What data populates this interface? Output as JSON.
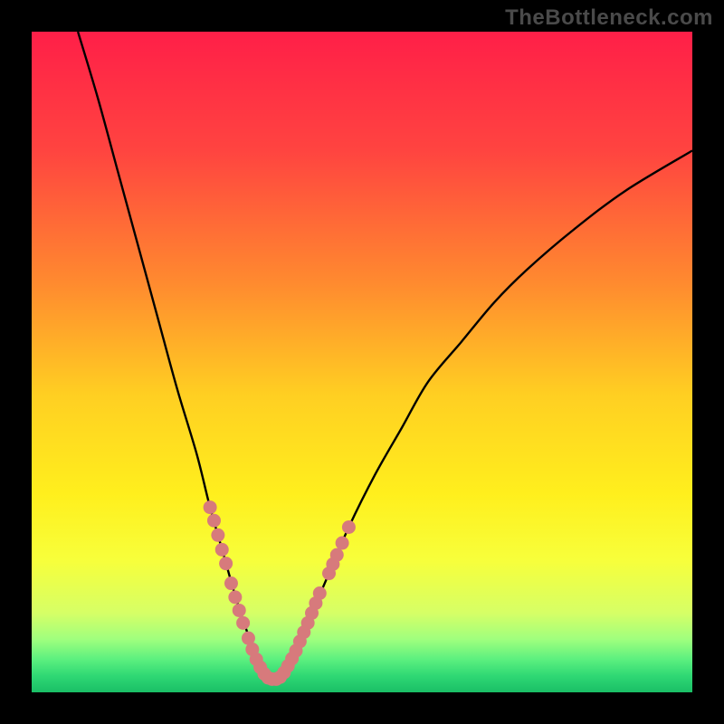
{
  "watermark": "TheBottleneck.com",
  "colors": {
    "frame": "#000000",
    "curve": "#000000",
    "markers": "#d77a7c",
    "gradient_stops": [
      {
        "offset": 0.0,
        "color": "#ff1f48"
      },
      {
        "offset": 0.18,
        "color": "#ff4440"
      },
      {
        "offset": 0.38,
        "color": "#ff8a2f"
      },
      {
        "offset": 0.55,
        "color": "#ffcf22"
      },
      {
        "offset": 0.7,
        "color": "#ffef1d"
      },
      {
        "offset": 0.8,
        "color": "#f7ff3b"
      },
      {
        "offset": 0.88,
        "color": "#d6ff66"
      },
      {
        "offset": 0.92,
        "color": "#9fff7e"
      },
      {
        "offset": 0.95,
        "color": "#5cf07f"
      },
      {
        "offset": 0.975,
        "color": "#2fd874"
      },
      {
        "offset": 1.0,
        "color": "#1abf66"
      }
    ]
  },
  "chart_data": {
    "type": "line",
    "title": "",
    "xlabel": "",
    "ylabel": "",
    "xlim": [
      0,
      100
    ],
    "ylim": [
      0,
      100
    ],
    "series": [
      {
        "name": "bottleneck-curve",
        "x": [
          7,
          10,
          13,
          16,
          19,
          22,
          25,
          27,
          29,
          31,
          33,
          34,
          35,
          36,
          37,
          38,
          40,
          42,
          45,
          48,
          52,
          56,
          60,
          65,
          70,
          75,
          82,
          90,
          100
        ],
        "values": [
          100,
          90,
          79,
          68,
          57,
          46,
          36,
          28,
          21,
          14,
          8,
          5,
          3,
          2,
          2,
          3,
          6,
          11,
          18,
          25,
          33,
          40,
          47,
          53,
          59,
          64,
          70,
          76,
          82
        ]
      }
    ],
    "markers": [
      {
        "x": 27.0,
        "y": 28.0
      },
      {
        "x": 27.6,
        "y": 26.0
      },
      {
        "x": 28.2,
        "y": 23.8
      },
      {
        "x": 28.8,
        "y": 21.6
      },
      {
        "x": 29.4,
        "y": 19.5
      },
      {
        "x": 30.2,
        "y": 16.5
      },
      {
        "x": 30.8,
        "y": 14.4
      },
      {
        "x": 31.4,
        "y": 12.4
      },
      {
        "x": 32.0,
        "y": 10.5
      },
      {
        "x": 32.8,
        "y": 8.2
      },
      {
        "x": 33.4,
        "y": 6.5
      },
      {
        "x": 34.0,
        "y": 5.0
      },
      {
        "x": 34.6,
        "y": 3.8
      },
      {
        "x": 35.2,
        "y": 2.8
      },
      {
        "x": 35.8,
        "y": 2.2
      },
      {
        "x": 36.4,
        "y": 2.0
      },
      {
        "x": 37.0,
        "y": 2.0
      },
      {
        "x": 37.6,
        "y": 2.3
      },
      {
        "x": 38.2,
        "y": 3.0
      },
      {
        "x": 38.8,
        "y": 4.0
      },
      {
        "x": 39.4,
        "y": 5.1
      },
      {
        "x": 40.0,
        "y": 6.3
      },
      {
        "x": 40.6,
        "y": 7.7
      },
      {
        "x": 41.2,
        "y": 9.1
      },
      {
        "x": 41.8,
        "y": 10.5
      },
      {
        "x": 42.4,
        "y": 12.0
      },
      {
        "x": 43.0,
        "y": 13.5
      },
      {
        "x": 43.6,
        "y": 15.0
      },
      {
        "x": 45.0,
        "y": 18.0
      },
      {
        "x": 45.6,
        "y": 19.4
      },
      {
        "x": 46.2,
        "y": 20.8
      },
      {
        "x": 47.0,
        "y": 22.6
      },
      {
        "x": 48.0,
        "y": 25.0
      }
    ]
  }
}
